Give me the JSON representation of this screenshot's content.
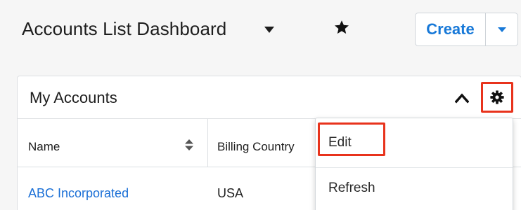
{
  "page": {
    "title": "Accounts List Dashboard",
    "title_menu_icon": "caret-down-icon",
    "favorite_icon": "star-icon"
  },
  "actions": {
    "create_label": "Create",
    "create_menu_icon": "caret-down-icon"
  },
  "dashlet": {
    "title": "My Accounts",
    "collapse_icon": "chevron-up-icon",
    "settings_icon": "gear-icon",
    "columns": [
      {
        "label": "Name",
        "sortable": true
      },
      {
        "label": "Billing Country"
      }
    ],
    "rows": [
      {
        "name": "ABC Incorporated",
        "billing_country": "USA"
      }
    ]
  },
  "settings_menu": {
    "items": [
      {
        "label": "Edit",
        "highlighted": true
      },
      {
        "label": "Refresh"
      }
    ]
  },
  "colors": {
    "accent": "#1879d8",
    "link": "#1a6fd6",
    "highlight": "#e8331c"
  }
}
